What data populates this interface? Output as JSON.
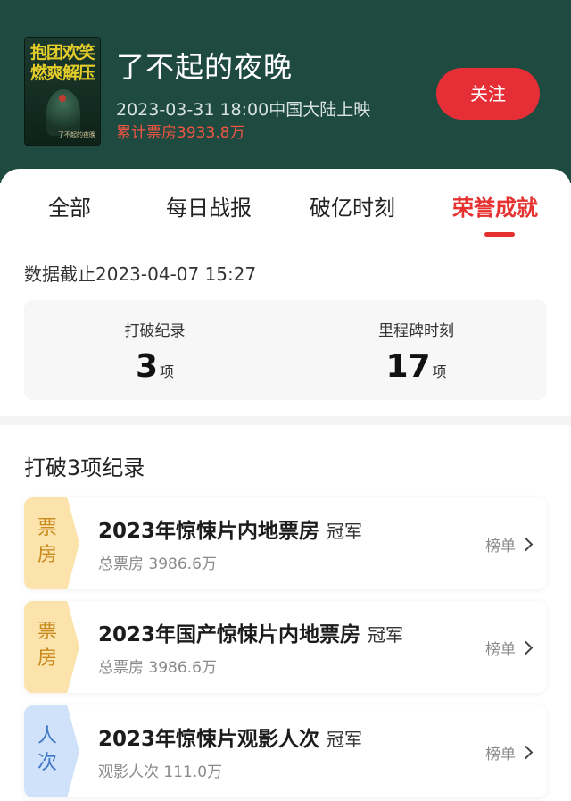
{
  "movie": {
    "poster_line1": "抱团欢笑",
    "poster_line2": "燃爽解压",
    "poster_caption": "了不起的夜晚",
    "title": "了不起的夜晚",
    "release": "2023-03-31 18:00中国大陆上映",
    "box_office": "累计票房3933.8万",
    "follow_label": "关注"
  },
  "tabs": [
    {
      "label": "全部"
    },
    {
      "label": "每日战报"
    },
    {
      "label": "破亿时刻"
    },
    {
      "label": "荣誉成就"
    }
  ],
  "active_tab": 3,
  "data_date": "数据截止2023-04-07  15:27",
  "stats": [
    {
      "label": "打破纪录",
      "value": "3",
      "unit": "项"
    },
    {
      "label": "里程碑时刻",
      "value": "17",
      "unit": "项"
    }
  ],
  "section_title": "打破3项纪录",
  "records": [
    {
      "tag1": "票",
      "tag2": "房",
      "title": "2023年惊悚片内地票房",
      "rank": "冠军",
      "sub": "总票房 3986.6万",
      "link": "榜单",
      "tag_color": "#fbe3ab"
    },
    {
      "tag1": "票",
      "tag2": "房",
      "title": "2023年国产惊悚片内地票房",
      "rank": "冠军",
      "sub": "总票房 3986.6万",
      "link": "榜单",
      "tag_color": "#fbe3ab"
    },
    {
      "tag1": "人",
      "tag2": "次",
      "title": "2023年惊悚片观影人次",
      "rank": "冠军",
      "sub": "观影人次 111.0万",
      "link": "榜单",
      "tag_color": "#cfe2f9"
    }
  ],
  "colors": {
    "header_bg": "#1f4a40",
    "accent_red": "#e5312f",
    "follow_button": "#e62e36",
    "box_office_text": "#f05442"
  },
  "icons": {
    "record_link": "chevron-right-icon"
  }
}
